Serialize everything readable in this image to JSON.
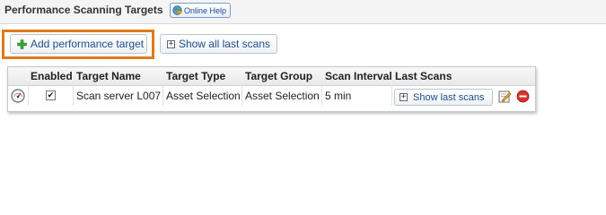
{
  "header": {
    "title": "Performance Scanning Targets",
    "help_label": "Online Help"
  },
  "toolbar": {
    "add_label": "Add performance target",
    "show_all_label": "Show all last scans"
  },
  "table": {
    "columns": [
      "Enabled",
      "Target Name",
      "Target Type",
      "Target Group",
      "Scan Interval",
      "Last Scans"
    ],
    "rows": [
      {
        "enabled": true,
        "enabled_glyph": "✔",
        "target_name": "Scan server L007",
        "target_type": "Asset Selection",
        "target_group": "Asset Selection",
        "scan_interval": "5 min",
        "last_scans_label": "Show last scans"
      }
    ]
  },
  "icons": {
    "help": "globe-help-icon",
    "add": "plus-green-icon",
    "expand": "plus-box-icon",
    "row_status": "gauge-icon",
    "edit": "pencil-edit-icon",
    "delete": "red-minus-circle-icon"
  },
  "colors": {
    "highlight": "#e07a1e",
    "link": "#1c4f8c",
    "delete": "#d9322b",
    "add": "#3aa63a"
  }
}
